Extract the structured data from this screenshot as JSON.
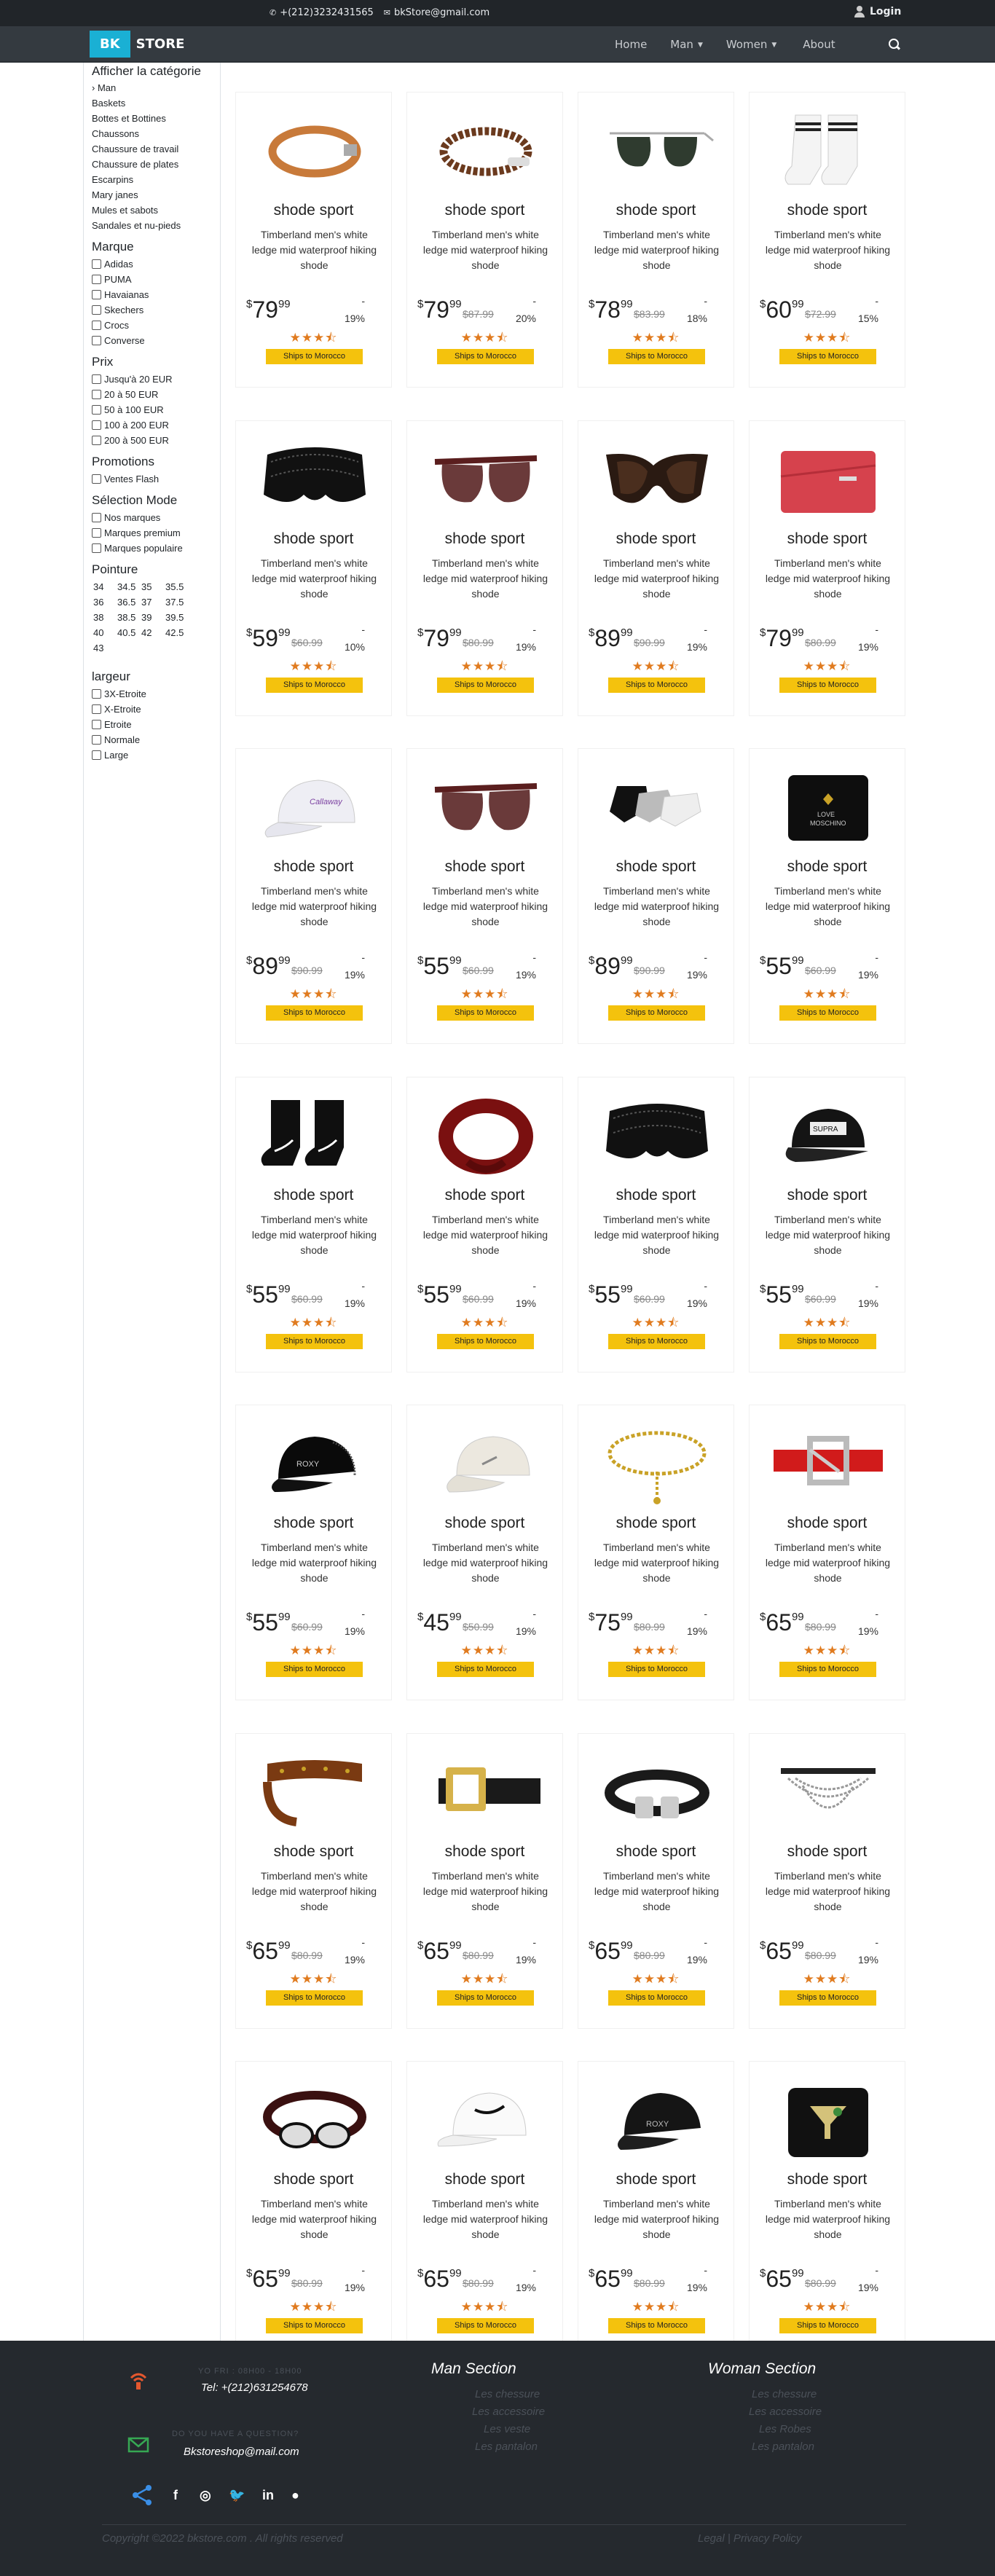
{
  "topbar": {
    "phone": "+(212)3232431565",
    "email": "bkStore@gmail.com",
    "login": "Login"
  },
  "navbar": {
    "brand_bk": "BK",
    "brand_store": "STORE",
    "home": "Home",
    "man": "Man",
    "women": "Women",
    "about": "About"
  },
  "sidebar": {
    "category_heading": "Afficher la catégorie",
    "categories": [
      "› Man",
      "Baskets",
      "Bottes et Bottines",
      "Chaussons",
      "Chaussure de travail",
      "Chaussure de plates",
      "Escarpins",
      "Mary janes",
      "Mules et sabots",
      "Sandales et nu-pieds"
    ],
    "brand_heading": "Marque",
    "brands": [
      "Adidas",
      "PUMA",
      "Havaianas",
      "Skechers",
      "Crocs",
      "Converse"
    ],
    "price_heading": "Prix",
    "prices": [
      "Jusqu'à 20 EUR",
      "20 à 50 EUR",
      "50 à 100 EUR",
      "100 à 200 EUR",
      "200 à 500 EUR"
    ],
    "promo_heading": "Promotions",
    "promos": [
      "Ventes Flash"
    ],
    "mode_heading": "Sélection Mode",
    "modes": [
      "Nos marques",
      "Marques premium",
      "Marques populaire"
    ],
    "size_heading": "Pointure",
    "sizes": [
      "34",
      "34.5",
      "35",
      "35.5",
      "36",
      "36.5",
      "37",
      "37.5",
      "38",
      "38.5",
      "39",
      "39.5",
      "40",
      "40.5",
      "42",
      "42.5",
      "43"
    ],
    "width_heading": "largeur",
    "widths": [
      "3X-Etroite",
      "X-Etroite",
      "Etroite",
      "Normale",
      "Large"
    ]
  },
  "products": [
    {
      "title": "shode sport",
      "desc": "Timberland men's white ledge mid waterproof hiking shode",
      "price_int": "79",
      "price_dec": "99",
      "old": "",
      "disc": "19%",
      "icon": "leather-bracelet-icon"
    },
    {
      "title": "shode sport",
      "desc": "Timberland men's white ledge mid waterproof hiking shode",
      "price_int": "79",
      "price_dec": "99",
      "old": "$87.99",
      "disc": "20%",
      "icon": "braided-bracelet-icon"
    },
    {
      "title": "shode sport",
      "desc": "Timberland men's white ledge mid waterproof hiking shode",
      "price_int": "78",
      "price_dec": "99",
      "old": "$83.99",
      "disc": "18%",
      "icon": "aviator-sunglasses-icon"
    },
    {
      "title": "shode sport",
      "desc": "Timberland men's white ledge mid waterproof hiking shode",
      "price_int": "60",
      "price_dec": "99",
      "old": "$72.99",
      "disc": "15%",
      "icon": "white-socks-icon"
    },
    {
      "title": "shode sport",
      "desc": "Timberland men's white ledge mid waterproof hiking shode",
      "price_int": "59",
      "price_dec": "99",
      "old": "$60.99",
      "disc": "10%",
      "icon": "lace-shawl-icon"
    },
    {
      "title": "shode sport",
      "desc": "Timberland men's white ledge mid waterproof hiking shode",
      "price_int": "79",
      "price_dec": "99",
      "old": "$80.99",
      "disc": "19%",
      "icon": "brown-sunglasses-icon"
    },
    {
      "title": "shode sport",
      "desc": "Timberland men's white ledge mid waterproof hiking shode",
      "price_int": "89",
      "price_dec": "99",
      "old": "$90.99",
      "disc": "19%",
      "icon": "cat-eye-sunglasses-icon"
    },
    {
      "title": "shode sport",
      "desc": "Timberland men's white ledge mid waterproof hiking shode",
      "price_int": "79",
      "price_dec": "99",
      "old": "$80.99",
      "disc": "19%",
      "icon": "red-clutch-icon"
    },
    {
      "title": "shode sport",
      "desc": "Timberland men's white ledge mid waterproof hiking shode",
      "price_int": "89",
      "price_dec": "99",
      "old": "$90.99",
      "disc": "19%",
      "icon": "white-cap-icon"
    },
    {
      "title": "shode sport",
      "desc": "Timberland men's white ledge mid waterproof hiking shode",
      "price_int": "55",
      "price_dec": "99",
      "old": "$60.99",
      "disc": "19%",
      "icon": "brown-sunglasses-icon"
    },
    {
      "title": "shode sport",
      "desc": "Timberland men's white ledge mid waterproof hiking shode",
      "price_int": "89",
      "price_dec": "99",
      "old": "$90.99",
      "disc": "19%",
      "icon": "ankle-socks-icon"
    },
    {
      "title": "shode sport",
      "desc": "Timberland men's white ledge mid waterproof hiking shode",
      "price_int": "55",
      "price_dec": "99",
      "old": "$60.99",
      "disc": "19%",
      "icon": "black-wallet-icon"
    },
    {
      "title": "shode sport",
      "desc": "Timberland men's white ledge mid waterproof hiking shode",
      "price_int": "55",
      "price_dec": "99",
      "old": "$60.99",
      "disc": "19%",
      "icon": "black-socks-icon"
    },
    {
      "title": "shode sport",
      "desc": "Timberland men's white ledge mid waterproof hiking shode",
      "price_int": "55",
      "price_dec": "99",
      "old": "$60.99",
      "disc": "19%",
      "icon": "red-headband-icon"
    },
    {
      "title": "shode sport",
      "desc": "Timberland men's white ledge mid waterproof hiking shode",
      "price_int": "55",
      "price_dec": "99",
      "old": "$60.99",
      "disc": "19%",
      "icon": "lace-shawl-icon"
    },
    {
      "title": "shode sport",
      "desc": "Timberland men's white ledge mid waterproof hiking shode",
      "price_int": "55",
      "price_dec": "99",
      "old": "$60.99",
      "disc": "19%",
      "icon": "black-cap-icon"
    },
    {
      "title": "shode sport",
      "desc": "Timberland men's white ledge mid waterproof hiking shode",
      "price_int": "55",
      "price_dec": "99",
      "old": "$60.99",
      "disc": "19%",
      "icon": "trucker-cap-icon"
    },
    {
      "title": "shode sport",
      "desc": "Timberland men's white ledge mid waterproof hiking shode",
      "price_int": "45",
      "price_dec": "99",
      "old": "$50.99",
      "disc": "19%",
      "icon": "beige-cap-icon"
    },
    {
      "title": "shode sport",
      "desc": "Timberland men's white ledge mid waterproof hiking shode",
      "price_int": "75",
      "price_dec": "99",
      "old": "$80.99",
      "disc": "19%",
      "icon": "chain-belt-icon"
    },
    {
      "title": "shode sport",
      "desc": "Timberland men's white ledge mid waterproof hiking shode",
      "price_int": "65",
      "price_dec": "99",
      "old": "$80.99",
      "disc": "19%",
      "icon": "red-belt-icon"
    },
    {
      "title": "shode sport",
      "desc": "Timberland men's white ledge mid waterproof hiking shode",
      "price_int": "65",
      "price_dec": "99",
      "old": "$80.99",
      "disc": "19%",
      "icon": "studded-belt-icon"
    },
    {
      "title": "shode sport",
      "desc": "Timberland men's white ledge mid waterproof hiking shode",
      "price_int": "65",
      "price_dec": "99",
      "old": "$80.99",
      "disc": "19%",
      "icon": "gold-buckle-belt-icon"
    },
    {
      "title": "shode sport",
      "desc": "Timberland men's white ledge mid waterproof hiking shode",
      "price_int": "65",
      "price_dec": "99",
      "old": "$80.99",
      "disc": "19%",
      "icon": "double-buckle-belt-icon"
    },
    {
      "title": "shode sport",
      "desc": "Timberland men's white ledge mid waterproof hiking shode",
      "price_int": "65",
      "price_dec": "99",
      "old": "$80.99",
      "disc": "19%",
      "icon": "chain-harness-icon"
    },
    {
      "title": "shode sport",
      "desc": "Timberland men's white ledge mid waterproof hiking shode",
      "price_int": "65",
      "price_dec": "99",
      "old": "$80.99",
      "disc": "19%",
      "icon": "bow-belt-icon"
    },
    {
      "title": "shode sport",
      "desc": "Timberland men's white ledge mid waterproof hiking shode",
      "price_int": "65",
      "price_dec": "99",
      "old": "$80.99",
      "disc": "19%",
      "icon": "white-nike-cap-icon"
    },
    {
      "title": "shode sport",
      "desc": "Timberland men's white ledge mid waterproof hiking shode",
      "price_int": "65",
      "price_dec": "99",
      "old": "$80.99",
      "disc": "19%",
      "icon": "roxy-cap-icon"
    },
    {
      "title": "shode sport",
      "desc": "Timberland men's white ledge mid waterproof hiking shode",
      "price_int": "65",
      "price_dec": "99",
      "old": "$80.99",
      "disc": "19%",
      "icon": "beaded-pouch-icon"
    }
  ],
  "card_common": {
    "currency": "$",
    "dash": "-",
    "stars": "★★★⯪",
    "ship": "Ships to Morocco"
  },
  "footer": {
    "hours_label": "YO FRI : 08H00 - 18H00",
    "phone": "Tel: +(212)631254678",
    "question_label": "DO YOU HAVE A QUESTION?",
    "email": "Bkstoreshop@mail.com",
    "man_title": "Man Section",
    "man_items": [
      "Les chessure",
      "Les accessoire",
      "Les veste",
      "Les pantalon"
    ],
    "woman_title": "Woman Section",
    "woman_items": [
      "Les chessure",
      "Les accessoire",
      "Les Robes",
      "Les pantalon"
    ],
    "copyright": "Copyright ©2022 bkstore.com . All rights reserved",
    "legal": "Legal  |  Privacy Policy"
  },
  "colors": {
    "accent": "#1ab0d4",
    "ship_badge": "#f4c20d",
    "star": "#e07b1f",
    "footer_bg": "#25292e"
  }
}
